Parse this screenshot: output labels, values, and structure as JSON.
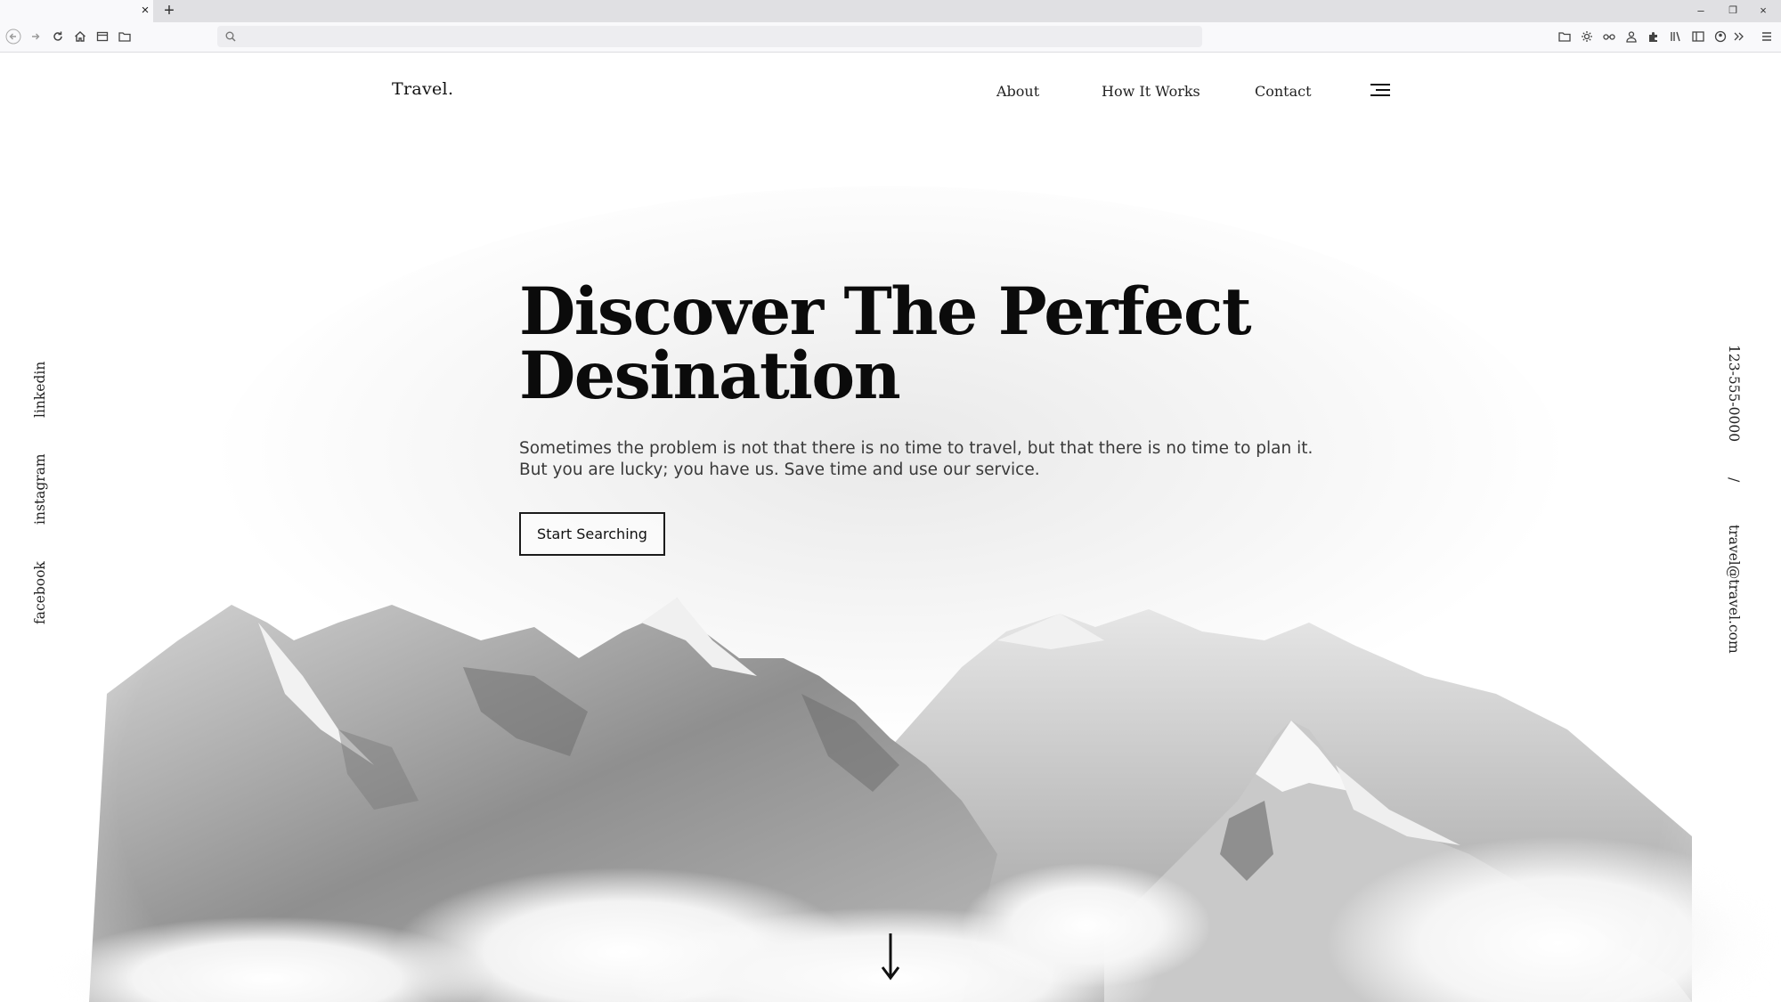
{
  "browser": {
    "tab_close": "×",
    "tab_new": "+",
    "window_controls": {
      "minimize": "–",
      "restore": "❐",
      "close": "×"
    },
    "url_value": "",
    "url_placeholder": ""
  },
  "site": {
    "logo": "Travel.",
    "nav": [
      {
        "label": "About"
      },
      {
        "label": "How It Works"
      },
      {
        "label": "Contact"
      }
    ],
    "menu_icon": "hamburger-menu-icon"
  },
  "hero": {
    "title_line_1": "Discover The Perfect",
    "title_line_2": "Desination",
    "description_line_1": "Sometimes the problem is not that there is no time to travel, but that there is no time to plan it.",
    "description_line_2": "But you are lucky; you have us. Save time and use our service.",
    "cta_label": "Start Searching",
    "scroll_icon": "arrow-down-icon"
  },
  "social": [
    {
      "label": "linkedin"
    },
    {
      "label": "instagram"
    },
    {
      "label": "facebook"
    }
  ],
  "contact": {
    "phone": "123-555-0000",
    "separator": "/",
    "email": "travel@travel.com"
  },
  "colors": {
    "text": "#111111",
    "page_bg": "#ffffff",
    "chrome_bg": "#f9f9fb",
    "tabbar_bg": "#e0e0e3"
  }
}
